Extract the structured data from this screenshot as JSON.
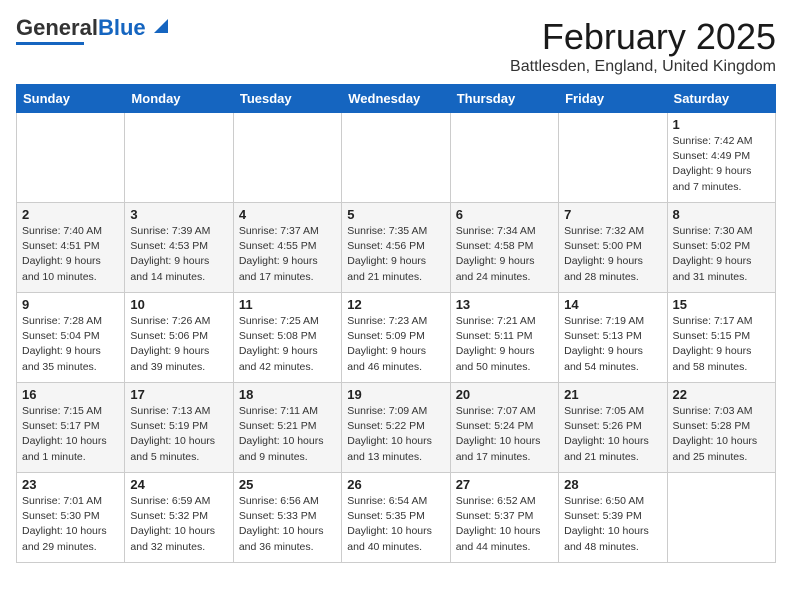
{
  "logo": {
    "line1": "General",
    "line2": "Blue"
  },
  "header": {
    "month": "February 2025",
    "location": "Battlesden, England, United Kingdom"
  },
  "weekdays": [
    "Sunday",
    "Monday",
    "Tuesday",
    "Wednesday",
    "Thursday",
    "Friday",
    "Saturday"
  ],
  "weeks": [
    [
      {
        "num": "",
        "info": ""
      },
      {
        "num": "",
        "info": ""
      },
      {
        "num": "",
        "info": ""
      },
      {
        "num": "",
        "info": ""
      },
      {
        "num": "",
        "info": ""
      },
      {
        "num": "",
        "info": ""
      },
      {
        "num": "1",
        "info": "Sunrise: 7:42 AM\nSunset: 4:49 PM\nDaylight: 9 hours\nand 7 minutes."
      }
    ],
    [
      {
        "num": "2",
        "info": "Sunrise: 7:40 AM\nSunset: 4:51 PM\nDaylight: 9 hours\nand 10 minutes."
      },
      {
        "num": "3",
        "info": "Sunrise: 7:39 AM\nSunset: 4:53 PM\nDaylight: 9 hours\nand 14 minutes."
      },
      {
        "num": "4",
        "info": "Sunrise: 7:37 AM\nSunset: 4:55 PM\nDaylight: 9 hours\nand 17 minutes."
      },
      {
        "num": "5",
        "info": "Sunrise: 7:35 AM\nSunset: 4:56 PM\nDaylight: 9 hours\nand 21 minutes."
      },
      {
        "num": "6",
        "info": "Sunrise: 7:34 AM\nSunset: 4:58 PM\nDaylight: 9 hours\nand 24 minutes."
      },
      {
        "num": "7",
        "info": "Sunrise: 7:32 AM\nSunset: 5:00 PM\nDaylight: 9 hours\nand 28 minutes."
      },
      {
        "num": "8",
        "info": "Sunrise: 7:30 AM\nSunset: 5:02 PM\nDaylight: 9 hours\nand 31 minutes."
      }
    ],
    [
      {
        "num": "9",
        "info": "Sunrise: 7:28 AM\nSunset: 5:04 PM\nDaylight: 9 hours\nand 35 minutes."
      },
      {
        "num": "10",
        "info": "Sunrise: 7:26 AM\nSunset: 5:06 PM\nDaylight: 9 hours\nand 39 minutes."
      },
      {
        "num": "11",
        "info": "Sunrise: 7:25 AM\nSunset: 5:08 PM\nDaylight: 9 hours\nand 42 minutes."
      },
      {
        "num": "12",
        "info": "Sunrise: 7:23 AM\nSunset: 5:09 PM\nDaylight: 9 hours\nand 46 minutes."
      },
      {
        "num": "13",
        "info": "Sunrise: 7:21 AM\nSunset: 5:11 PM\nDaylight: 9 hours\nand 50 minutes."
      },
      {
        "num": "14",
        "info": "Sunrise: 7:19 AM\nSunset: 5:13 PM\nDaylight: 9 hours\nand 54 minutes."
      },
      {
        "num": "15",
        "info": "Sunrise: 7:17 AM\nSunset: 5:15 PM\nDaylight: 9 hours\nand 58 minutes."
      }
    ],
    [
      {
        "num": "16",
        "info": "Sunrise: 7:15 AM\nSunset: 5:17 PM\nDaylight: 10 hours\nand 1 minute."
      },
      {
        "num": "17",
        "info": "Sunrise: 7:13 AM\nSunset: 5:19 PM\nDaylight: 10 hours\nand 5 minutes."
      },
      {
        "num": "18",
        "info": "Sunrise: 7:11 AM\nSunset: 5:21 PM\nDaylight: 10 hours\nand 9 minutes."
      },
      {
        "num": "19",
        "info": "Sunrise: 7:09 AM\nSunset: 5:22 PM\nDaylight: 10 hours\nand 13 minutes."
      },
      {
        "num": "20",
        "info": "Sunrise: 7:07 AM\nSunset: 5:24 PM\nDaylight: 10 hours\nand 17 minutes."
      },
      {
        "num": "21",
        "info": "Sunrise: 7:05 AM\nSunset: 5:26 PM\nDaylight: 10 hours\nand 21 minutes."
      },
      {
        "num": "22",
        "info": "Sunrise: 7:03 AM\nSunset: 5:28 PM\nDaylight: 10 hours\nand 25 minutes."
      }
    ],
    [
      {
        "num": "23",
        "info": "Sunrise: 7:01 AM\nSunset: 5:30 PM\nDaylight: 10 hours\nand 29 minutes."
      },
      {
        "num": "24",
        "info": "Sunrise: 6:59 AM\nSunset: 5:32 PM\nDaylight: 10 hours\nand 32 minutes."
      },
      {
        "num": "25",
        "info": "Sunrise: 6:56 AM\nSunset: 5:33 PM\nDaylight: 10 hours\nand 36 minutes."
      },
      {
        "num": "26",
        "info": "Sunrise: 6:54 AM\nSunset: 5:35 PM\nDaylight: 10 hours\nand 40 minutes."
      },
      {
        "num": "27",
        "info": "Sunrise: 6:52 AM\nSunset: 5:37 PM\nDaylight: 10 hours\nand 44 minutes."
      },
      {
        "num": "28",
        "info": "Sunrise: 6:50 AM\nSunset: 5:39 PM\nDaylight: 10 hours\nand 48 minutes."
      },
      {
        "num": "",
        "info": ""
      }
    ]
  ]
}
